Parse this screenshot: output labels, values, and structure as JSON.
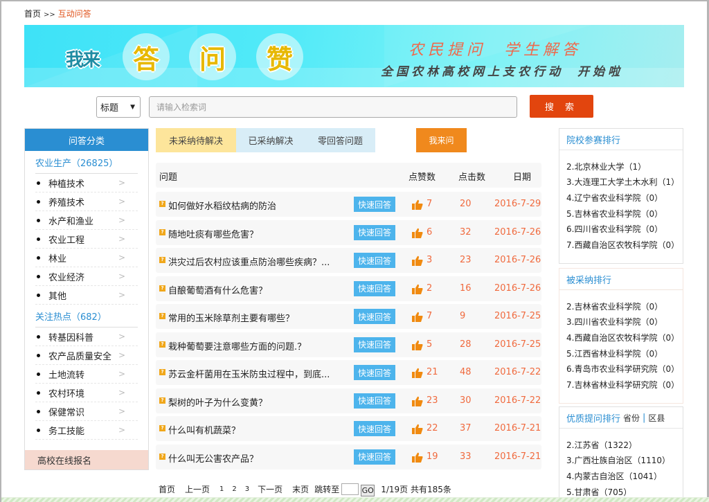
{
  "breadcrumb": {
    "home": "首页",
    "separator": ">>",
    "current": "互动问答"
  },
  "banner": {
    "prefix": "我来",
    "circles": [
      "答",
      "问",
      "赞"
    ],
    "slogan_line1_a": "农民提问",
    "slogan_line1_b": "学生解答",
    "slogan_line2_a": "全国农林高校网上支农行动",
    "slogan_line2_b": "开始啦"
  },
  "search": {
    "select_value": "标题",
    "placeholder": "请输入检索词",
    "button_label": "搜 索"
  },
  "sidebar": {
    "title": "问答分类",
    "groups": [
      {
        "title": "农业生产（26825）",
        "items": [
          "种植技术",
          "养殖技术",
          "水产和渔业",
          "农业工程",
          "林业",
          "农业经济",
          "其他"
        ]
      },
      {
        "title": "关注热点（682）",
        "items": [
          "转基因科普",
          "农产品质量安全",
          "土地流转",
          "农村环境",
          "保健常识",
          "务工技能"
        ]
      }
    ],
    "footer_link": "高校在线报名"
  },
  "tabs": [
    {
      "label": "未采纳待解决",
      "active": true
    },
    {
      "label": "已采纳解决",
      "active": false
    },
    {
      "label": "零回答问题",
      "active": false
    }
  ],
  "ask_button": "我来问",
  "table": {
    "headers": {
      "question": "问题",
      "likes": "点赞数",
      "clicks": "点击数",
      "date": "日期"
    },
    "quick_answer_label": "快速回答",
    "rows": [
      {
        "title": "如何做好水稻纹枯病的防治",
        "likes": "7",
        "clicks": "20",
        "date": "2016-7-29"
      },
      {
        "title": "随地吐痰有哪些危害？",
        "likes": "6",
        "clicks": "32",
        "date": "2016-7-26"
      },
      {
        "title": "洪灾过后农村应该重点防治哪些疾病？...",
        "likes": "3",
        "clicks": "23",
        "date": "2016-7-26"
      },
      {
        "title": "自酿葡萄酒有什么危害？",
        "likes": "2",
        "clicks": "16",
        "date": "2016-7-26"
      },
      {
        "title": "常用的玉米除草剂主要有哪些？",
        "likes": "7",
        "clicks": "9",
        "date": "2016-7-25"
      },
      {
        "title": "栽种葡萄要注意哪些方面的问题.？",
        "likes": "5",
        "clicks": "28",
        "date": "2016-7-25"
      },
      {
        "title": "苏云金杆菌用在玉米防虫过程中，到底...",
        "likes": "21",
        "clicks": "48",
        "date": "2016-7-22"
      },
      {
        "title": "梨树的叶子为什么变黄？",
        "likes": "23",
        "clicks": "30",
        "date": "2016-7-22"
      },
      {
        "title": "什么叫有机蔬菜？",
        "likes": "22",
        "clicks": "37",
        "date": "2016-7-21"
      },
      {
        "title": "什么叫无公害农产品？",
        "likes": "19",
        "clicks": "33",
        "date": "2016-7-21"
      }
    ]
  },
  "pagination": {
    "first": "首页",
    "prev": "上一页",
    "pages": [
      "1",
      "2",
      "3"
    ],
    "next": "下一页",
    "last": "末页",
    "jump_label": "跳转至",
    "jump_value": "",
    "go_label": "GO",
    "summary": "1/19页 共有185条"
  },
  "right_panels": [
    {
      "title": "院校参赛排行",
      "items": [
        "2.北京林业大学（1）",
        "3.大连理工大学土木水利（1）",
        "4.辽宁省农业科学院（0）",
        "5.吉林省农业科学院（0）",
        "6.四川省农业科学院（0）",
        "7.西藏自治区农牧科学院（0）"
      ]
    },
    {
      "title": "被采纳排行",
      "items": [
        "2.吉林省农业科学院（0）",
        "3.四川省农业科学院（0）",
        "4.西藏自治区农牧科学院（0）",
        "5.江西省林业科学院（0）",
        "6.青岛市农业科学研究院（0）",
        "7.吉林省林业科学研究院（0）"
      ]
    },
    {
      "title": "优质提问排行",
      "sub_links": [
        "省份",
        "区县"
      ],
      "items": [
        "2.江苏省（1322）",
        "3.广西壮族自治区（1110）",
        "4.内蒙古自治区（1041）",
        "5.甘肃省（705）"
      ]
    }
  ],
  "colors": {
    "accent_blue": "#2a8ed2",
    "search_button": "#e2450e",
    "ask_button": "#f0891d",
    "quick_answer": "#4db4ec",
    "number_text": "#f06a3e",
    "active_tab": "#fde59b",
    "inactive_tab": "#d8edf7"
  }
}
